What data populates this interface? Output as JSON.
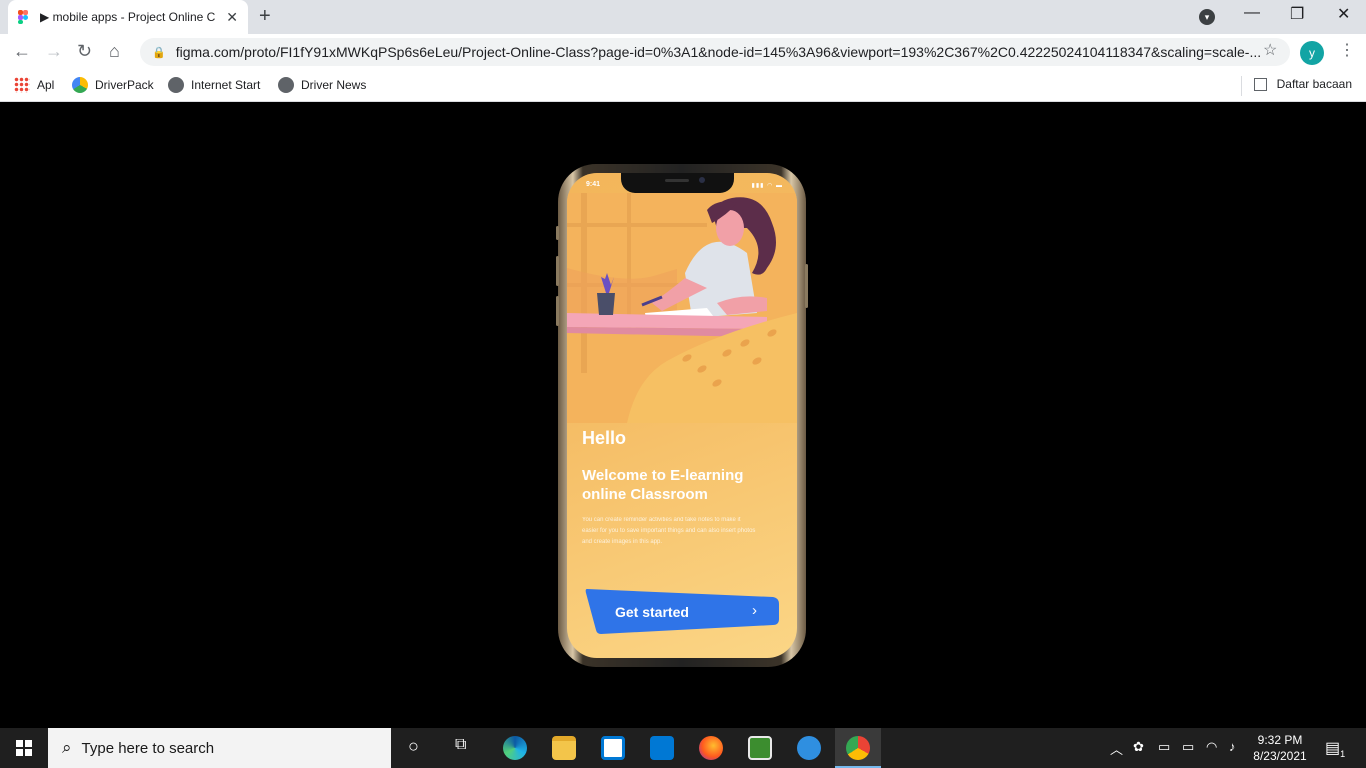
{
  "browser": {
    "tab_title": "▶ mobile apps - Project Online C",
    "tab_close": "✕",
    "new_tab": "+",
    "address": "figma.com/proto/FI1fY91xMWKqPSp6s6eLeu/Project-Online-Class?page-id=0%3A1&node-id=145%3A96&viewport=193%2C367%2C0.42225024104118347&scaling=scale-...",
    "avatar_letter": "y",
    "window_controls": {
      "minimize": "—",
      "maximize": "❐",
      "close": "✕"
    },
    "bookmarks": [
      {
        "label": "Apl"
      },
      {
        "label": "DriverPack"
      },
      {
        "label": "Internet Start"
      },
      {
        "label": "Driver News"
      }
    ],
    "reading_list": "Daftar bacaan"
  },
  "app": {
    "status_time": "9:41",
    "hello": "Hello",
    "welcome": "Welcome to E-learning online Classroom",
    "description": "You can create reminder activities and take notes to make it easier for you to save important things and can also insert photos and create images in this app.",
    "cta_label": "Get started",
    "cta_chevron": "›"
  },
  "taskbar": {
    "search_placeholder": "Type here to search",
    "time": "9:32 PM",
    "date": "8/23/2021",
    "notification_count": "1"
  },
  "colors": {
    "accent_blue": "#2f74e8",
    "bg_orange": "#f4bb63",
    "desk_pink": "#f4a6b7"
  }
}
